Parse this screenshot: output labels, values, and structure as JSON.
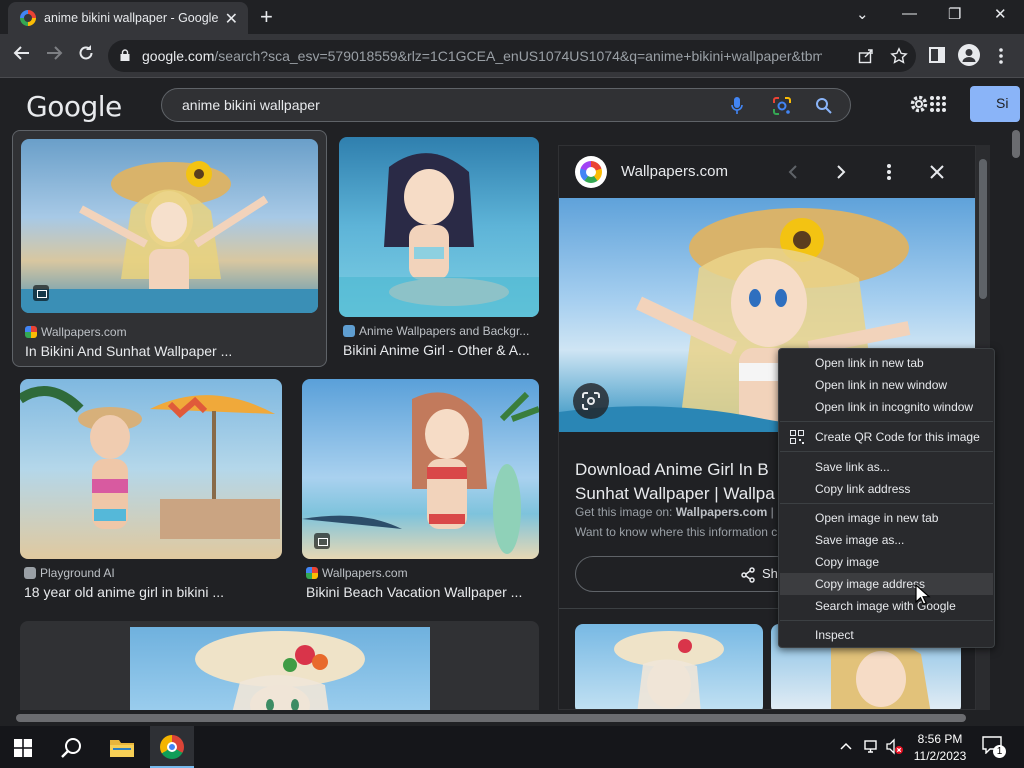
{
  "tab": {
    "title": "anime bikini wallpaper - Google Search",
    "close": "✕"
  },
  "new_tab": "+",
  "window": {
    "minimize": "—",
    "restore": "❐",
    "close": "✕",
    "menu": "⌄"
  },
  "address_bar": {
    "url_domain": "google.com",
    "url_rest": "/search?sca_esv=579018559&rlz=1C1GCEA_enUS1074US1074&q=anime+bikini+wallpaper&tbm=is..."
  },
  "google": {
    "logo": "Google",
    "query": "anime bikini wallpaper",
    "sign_in": "Si"
  },
  "results": [
    {
      "source": "Wallpapers.com",
      "caption": "In Bikini And Sunhat Wallpaper ..."
    },
    {
      "source": "Anime Wallpapers and Backgr...",
      "caption": "Bikini Anime Girl - Other & A..."
    },
    {
      "source": "Playground AI",
      "caption": "18 year old anime girl in bikini ..."
    },
    {
      "source": "Wallpapers.com",
      "caption": "Bikini Beach Vacation Wallpaper ..."
    }
  ],
  "preview": {
    "source": "Wallpapers.com",
    "title_line1": "Download Anime Girl In B",
    "title_line2": "Sunhat Wallpaper | Wallpa",
    "get_image_prefix": "Get this image on:",
    "get_image_site": "Wallpapers.com",
    "get_image_suffix": "| L",
    "want_to_know": "Want to know where this information c",
    "share_label": "Sha"
  },
  "context_menu": {
    "items": [
      "Open link in new tab",
      "Open link in new window",
      "Open link in incognito window",
      "Create QR Code for this image",
      "Save link as...",
      "Copy link address",
      "Open image in new tab",
      "Save image as...",
      "Copy image",
      "Copy image address",
      "Search image with Google",
      "Inspect"
    ],
    "highlighted": "Copy image address"
  },
  "taskbar": {
    "time": "8:56 PM",
    "date": "11/2/2023",
    "notifications": "1"
  },
  "colors": {
    "accent_blue": "#8ab4f8",
    "background": "#202124",
    "toolbar": "#35363a",
    "menu": "#292a2d"
  }
}
